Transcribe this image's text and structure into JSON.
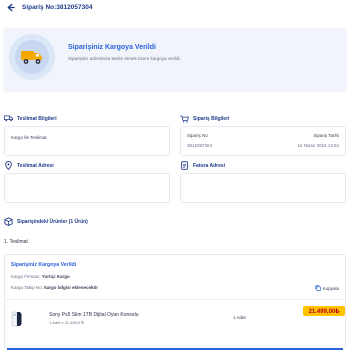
{
  "header": {
    "title": "Sipariş No:3812057304",
    "back_icon": "arrow-left-icon"
  },
  "hero": {
    "title": "Siparişiniz Kargoya Verildi",
    "description": "Siparişiniz adresinize teslim etmek üzere kargoya verildi.",
    "icon": "truck-icon"
  },
  "delivery": {
    "heading": "Teslimat Bilgileri",
    "value": "Kargo İle Teslimat",
    "icon": "truck-icon"
  },
  "order_info": {
    "heading": "Sipariş Bilgileri",
    "no_label": "Sipariş No",
    "no_value": "3812057304",
    "date_label": "Sipariş Tarihi",
    "date_value": "16 Nisan 2024 13:52",
    "icon": "cart-icon"
  },
  "delivery_address": {
    "heading": "Teslimat Adresi",
    "icon": "location-pin-icon"
  },
  "invoice_address": {
    "heading": "Fatura Adresi",
    "icon": "document-icon"
  },
  "products": {
    "heading": "Siparişindeki Ürünler (1 Ürün)",
    "icon": "box-icon"
  },
  "delivery_group": {
    "label": "1. Teslimat"
  },
  "shipment": {
    "title": "Siparişiniz Kargoya Verildi",
    "company_label": "Kargo Firması:",
    "company_value": "Yurtiçi Kargo",
    "tracking_label": "Kargo Takip No:",
    "tracking_value": "kargo bilgisi eklenecektir",
    "copy_label": "Kopyala"
  },
  "product": {
    "name": "Sony Ps5 Slim 1TB Dijital Oyun Konsolu",
    "sub": "1 Adet x 21.499,0 ₺",
    "qty": "1 Adet",
    "price": "21.499,00₺"
  },
  "colors": {
    "accent": "#2b62d9",
    "navy": "#1f3a8a",
    "price_bg": "#ffc400",
    "price_text": "#c0001a"
  }
}
